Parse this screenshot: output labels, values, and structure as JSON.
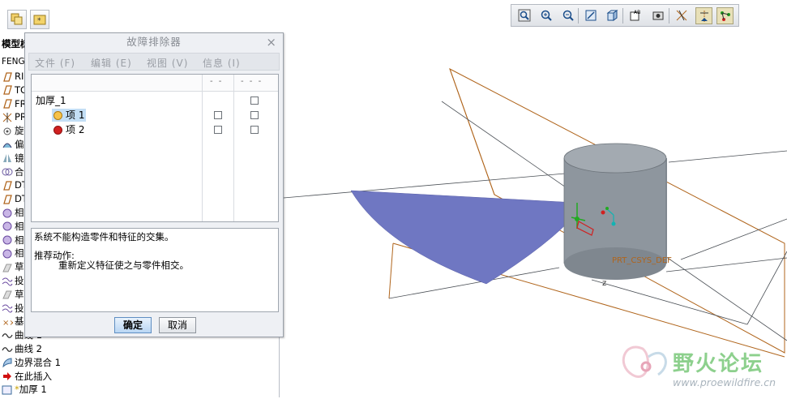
{
  "toolbar_left": {
    "buttons": [
      {
        "icon": "copy-layers-icon"
      },
      {
        "icon": "new-folder-star-icon"
      }
    ]
  },
  "tree": {
    "header": "模型树",
    "root": "FENGSHAN",
    "items": [
      {
        "label": "RI",
        "icon": "datum-plane-icon"
      },
      {
        "label": "TO",
        "icon": "datum-plane-icon"
      },
      {
        "label": "FR",
        "icon": "datum-plane-icon"
      },
      {
        "label": "PR",
        "icon": "csys-icon"
      },
      {
        "label": "旋",
        "icon": "revolve-icon"
      },
      {
        "label": "偏",
        "icon": "offset-icon"
      },
      {
        "label": "镜",
        "icon": "mirror-icon"
      },
      {
        "label": "合",
        "icon": "merge-icon"
      },
      {
        "label": "DT",
        "icon": "datum-plane-icon"
      },
      {
        "label": "DT",
        "icon": "datum-plane-icon"
      },
      {
        "label": "相",
        "icon": "intersect-icon"
      },
      {
        "label": "相",
        "icon": "intersect-icon"
      },
      {
        "label": "相",
        "icon": "intersect-icon"
      },
      {
        "label": "相",
        "icon": "intersect-icon"
      },
      {
        "label": "草",
        "icon": "sketch-icon"
      },
      {
        "label": "投",
        "icon": "project-curve-icon"
      },
      {
        "label": "草",
        "icon": "sketch-icon"
      },
      {
        "label": "投",
        "icon": "project-curve-icon"
      },
      {
        "label": "基",
        "icon": "datum-point-icon"
      },
      {
        "label": "曲线 1",
        "icon": "curve-icon"
      },
      {
        "label": "曲线 2",
        "icon": "curve-icon"
      },
      {
        "label": "边界混合 1",
        "icon": "boundary-blend-icon"
      },
      {
        "label": "在此插入",
        "icon": "insert-arrow-icon"
      },
      {
        "label": "加厚 1",
        "icon": "thicken-icon"
      }
    ]
  },
  "viewport_toolbar": {
    "buttons": [
      {
        "icon": "zoom-window-icon",
        "active": false
      },
      {
        "icon": "zoom-in-icon",
        "active": false
      },
      {
        "icon": "zoom-out-icon",
        "active": false
      },
      {
        "icon": "repaint-icon",
        "active": false
      },
      {
        "icon": "shading-icon",
        "active": false
      },
      {
        "icon": "saved-views-icon",
        "active": false
      },
      {
        "icon": "view-manager-icon",
        "active": false
      },
      {
        "icon": "datum-planes-toggle-icon",
        "active": false
      },
      {
        "icon": "datum-axes-toggle-icon",
        "active": true
      },
      {
        "icon": "datum-points-toggle-icon",
        "active": true
      }
    ]
  },
  "dialog": {
    "title": "故障排除器",
    "close": "×",
    "menu": [
      "文件 (F)",
      "编辑 (E)",
      "视图 (V)",
      "信息 (I)"
    ],
    "columns": [
      "- -",
      "- - -"
    ],
    "rows": [
      {
        "label": "加厚_1",
        "indent": false,
        "dot": null,
        "selected": false,
        "checks": [
          false,
          true
        ]
      },
      {
        "label": "项 1",
        "indent": true,
        "dot": "#f0b030",
        "selected": true,
        "checks": [
          true,
          true
        ]
      },
      {
        "label": "项 2",
        "indent": true,
        "dot": "#d02020",
        "selected": false,
        "checks": [
          true,
          true
        ]
      }
    ],
    "message": "系统不能构造零件和特征的交集。",
    "recommend_label": "推荐动作:",
    "recommend_text": "重新定义特征使之与零件相交。",
    "ok": "确定",
    "cancel": "取消"
  },
  "viewport": {
    "csys_label": "PRT_CSYS_DEF",
    "axis_label": "z",
    "surface_color": "#6f77c2",
    "cylinder_color": "#8e969e",
    "plane_color": "#b0651c"
  },
  "watermark": {
    "name": "野火论坛",
    "url": "www.proewildfire.cn"
  }
}
